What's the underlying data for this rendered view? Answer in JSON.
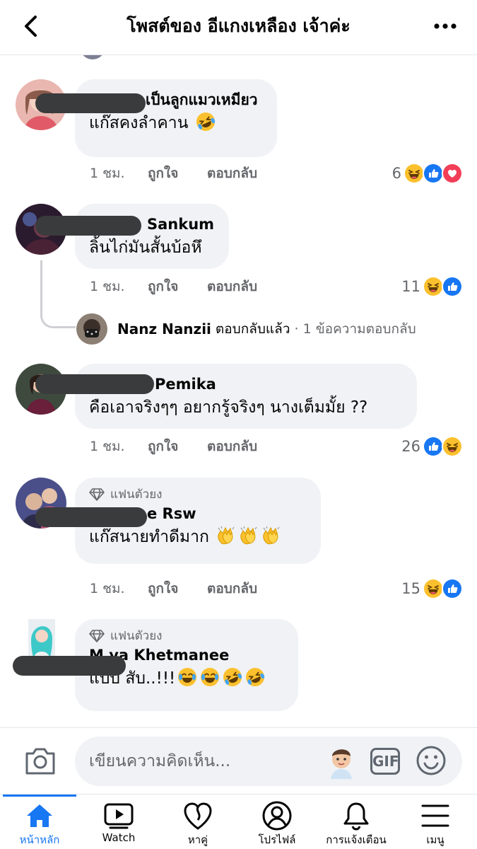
{
  "header": {
    "title": "โพสต์ของ อีแกงเหลือง เจ้าค่ะ"
  },
  "comments": [
    {
      "author": "เป็นลูกแมวเหมียว",
      "text": "แก๊สคงลำคาน",
      "time": "1 ชม.",
      "reaction_count": "6",
      "reactions": [
        "haha",
        "like",
        "love"
      ],
      "text_emojis": [
        "rofl"
      ]
    },
    {
      "author": "Sankum",
      "text": "ลิ้นไก่มันสั้นบ้อหึ",
      "time": "1 ชม.",
      "reaction_count": "11",
      "reactions": [
        "haha",
        "like"
      ],
      "reply_preview": {
        "name": "Nanz Nanzii",
        "action": "ตอบกลับแล้ว",
        "meta": "· 1 ข้อความตอบกลับ"
      }
    },
    {
      "author": "Pemika",
      "text": "คือเอาจริงๆๆ อยากรู้จริงๆ นางเต็มมั้ย ??",
      "time": "1 ชม.",
      "reaction_count": "26",
      "reactions": [
        "like",
        "haha"
      ]
    },
    {
      "badge": "แฟนตัวยง",
      "author": "e Rsw",
      "text": "แก๊สนายทำดีมาก",
      "time": "1 ชม.",
      "reaction_count": "15",
      "reactions": [
        "haha",
        "like"
      ],
      "text_emojis": [
        "clap",
        "clap",
        "clap"
      ]
    },
    {
      "badge": "แฟนตัวยง",
      "author": "M  ya Khetmanee",
      "text": "แบบ สับ..!!!",
      "text_emojis": [
        "joy",
        "joy",
        "rofl",
        "rofl"
      ]
    }
  ],
  "comment_actions": {
    "like": "ถูกใจ",
    "reply": "ตอบกลับ"
  },
  "composer": {
    "placeholder": "เขียนความคิดเห็น...",
    "gif_label": "GIF"
  },
  "tabs": [
    {
      "label": "หน้าหลัก",
      "icon": "home-icon",
      "active": true
    },
    {
      "label": "Watch",
      "icon": "watch-icon"
    },
    {
      "label": "หาคู่",
      "icon": "dating-heart-icon"
    },
    {
      "label": "โปรไฟล์",
      "icon": "profile-icon"
    },
    {
      "label": "การแจ้งเตือน",
      "icon": "bell-icon"
    },
    {
      "label": "เมนู",
      "icon": "menu-icon"
    }
  ],
  "colors": {
    "accent": "#1877f2",
    "bubble": "#f0f2f5",
    "secondary_text": "#65676b",
    "redaction": "#3a3b3c"
  }
}
